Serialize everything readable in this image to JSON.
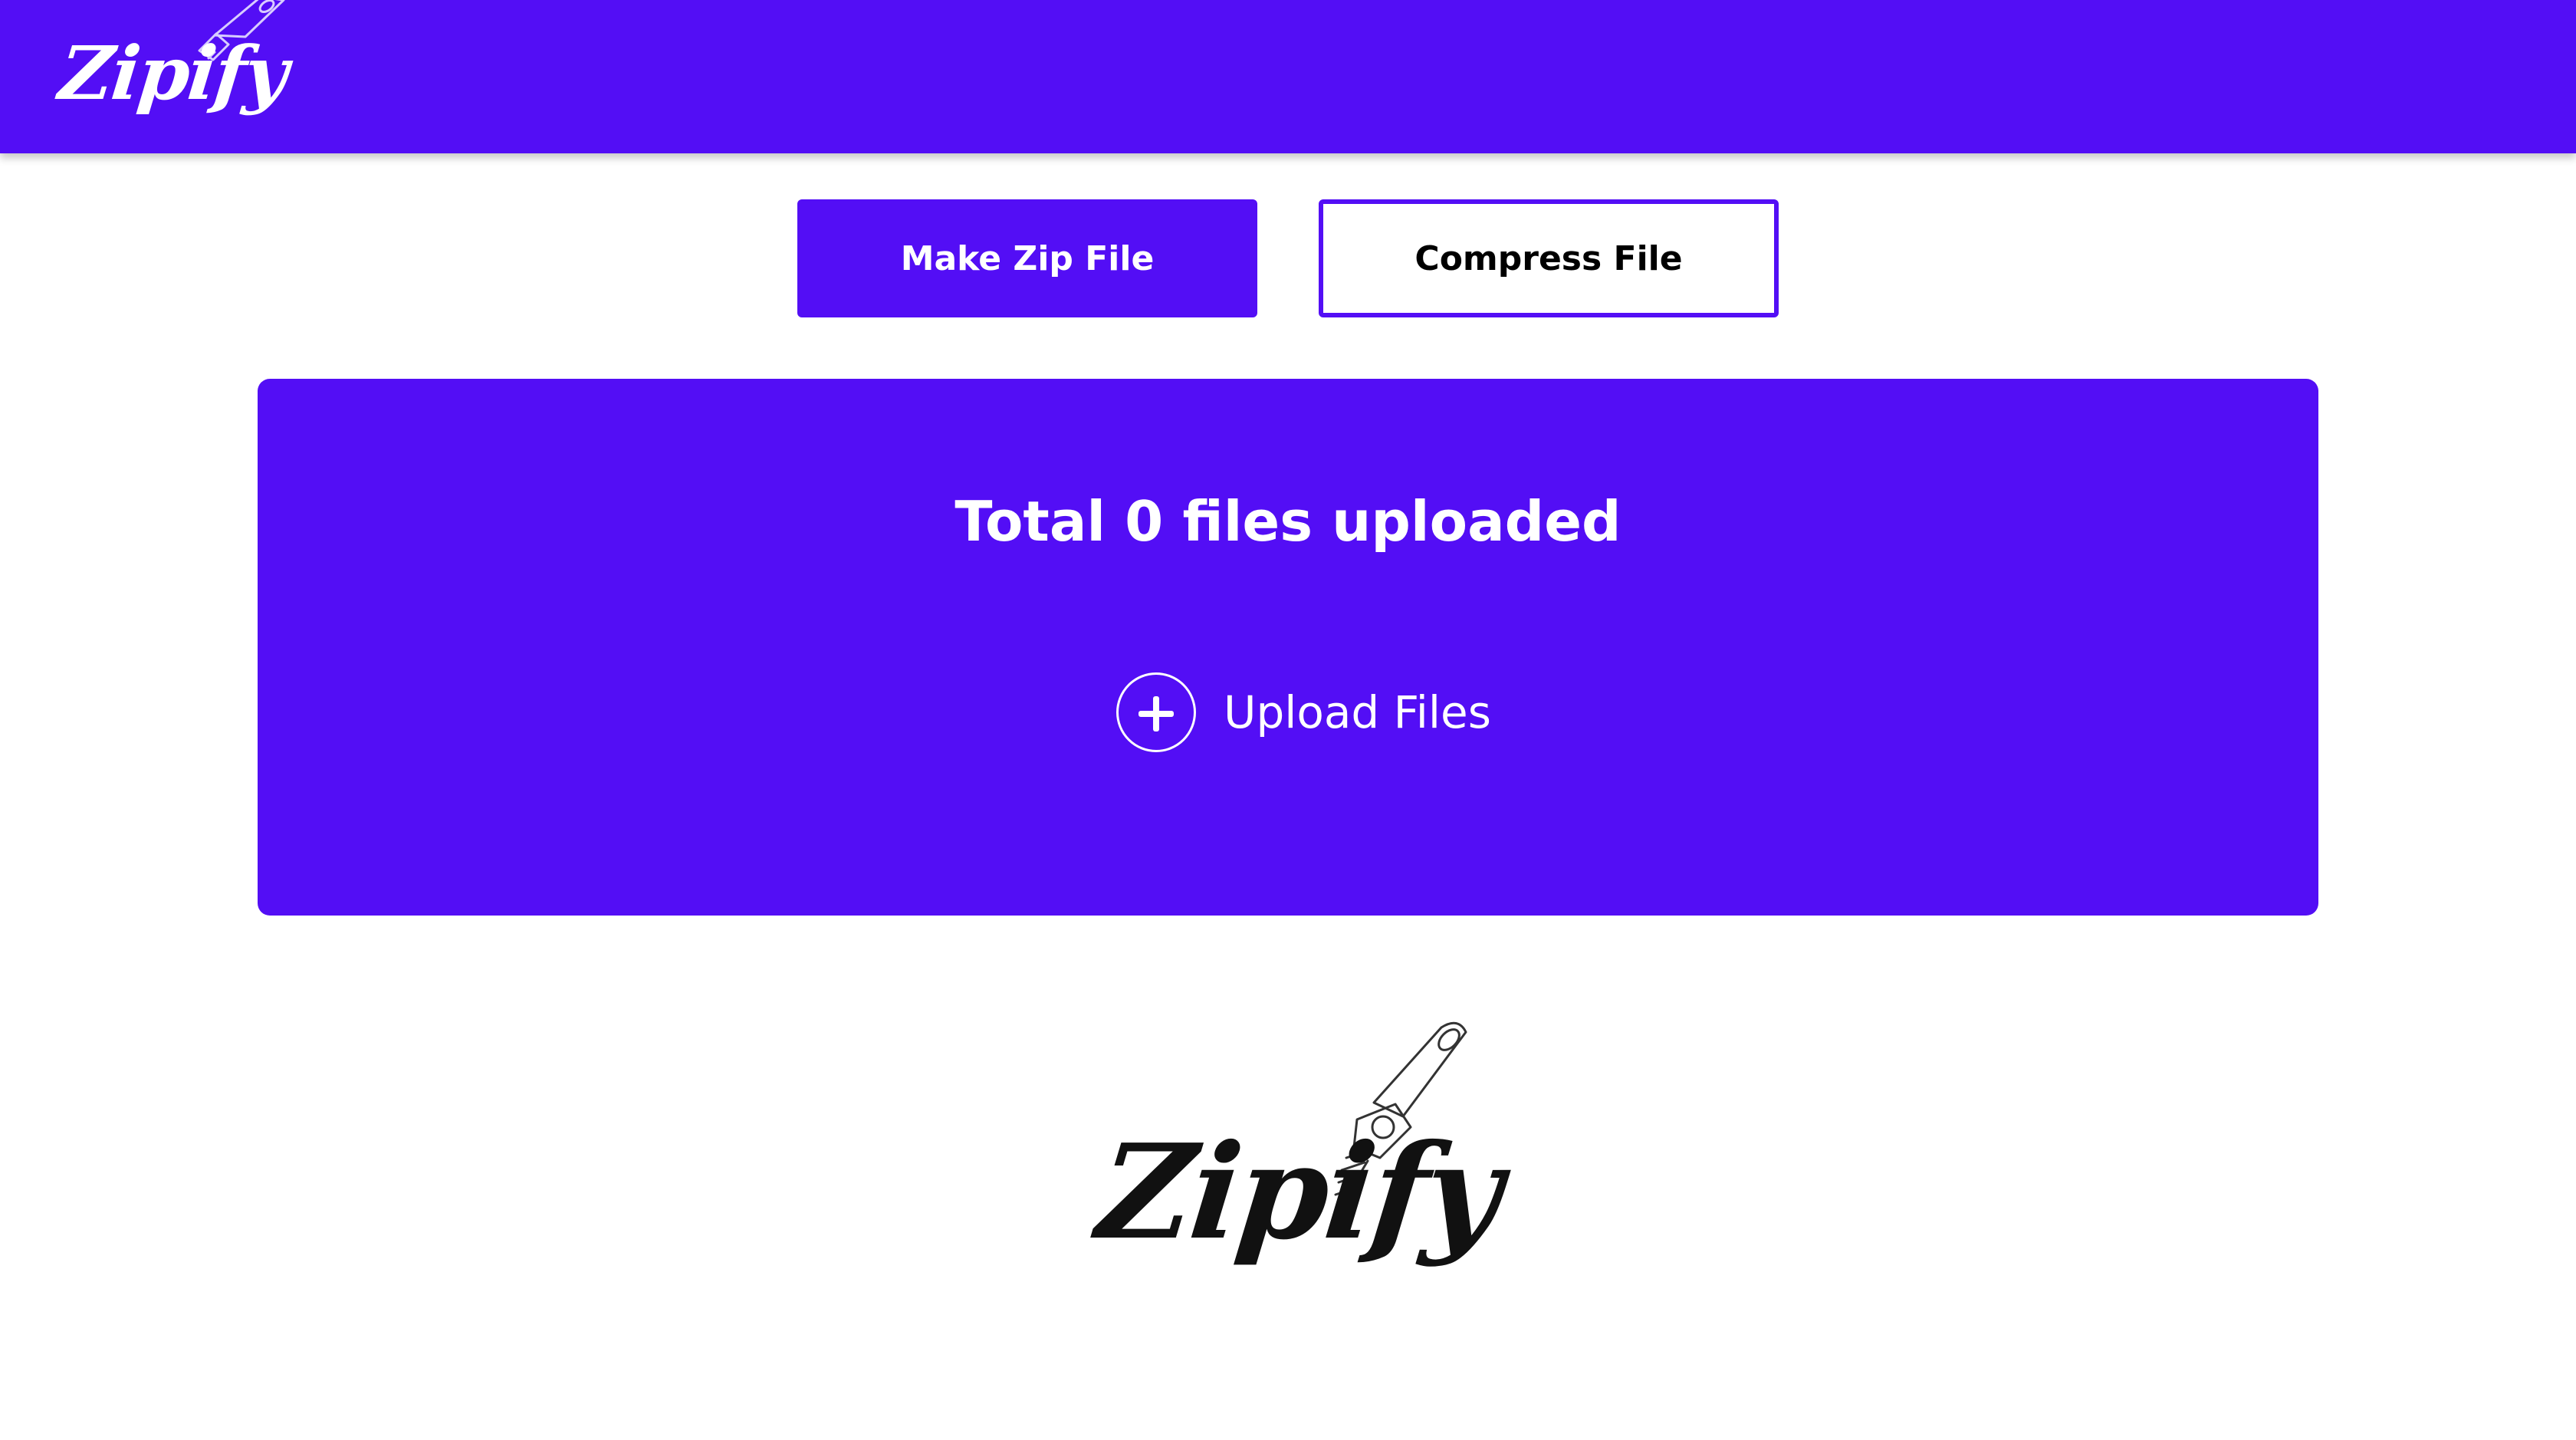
{
  "header": {
    "logo_text": "Zipify"
  },
  "modes": {
    "make_zip_label": "Make Zip File",
    "compress_label": "Compress File",
    "active": "make_zip"
  },
  "upload": {
    "title": "Total 0 files uploaded",
    "button_label": "Upload Files",
    "plus_icon": "plus-circle-icon"
  },
  "footer": {
    "logo_text": "Zipify",
    "logo_icon": "zipper-pull-icon"
  },
  "colors": {
    "brand": "#530ef5",
    "background": "#ffffff",
    "text_on_brand": "#ffffff",
    "logo_dark": "#111111"
  }
}
